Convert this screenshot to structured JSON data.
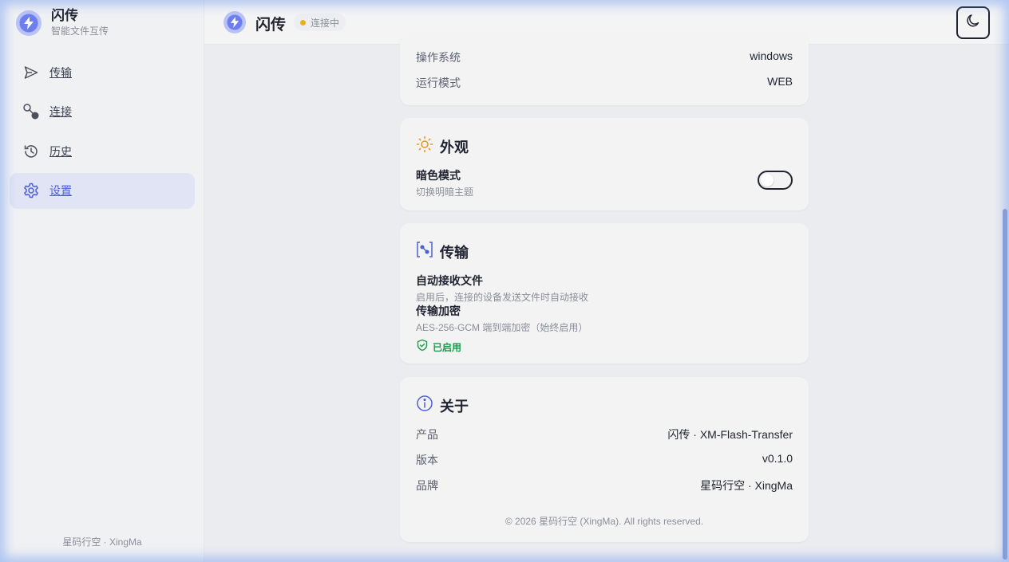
{
  "app": {
    "name": "闪传",
    "subtitle": "智能文件互传",
    "footer": "星码行空 · XingMa"
  },
  "sidebar": {
    "items": [
      {
        "label": "传输",
        "icon": "send-icon",
        "active": false
      },
      {
        "label": "连接",
        "icon": "connection-icon",
        "active": false
      },
      {
        "label": "历史",
        "icon": "history-icon",
        "active": false
      },
      {
        "label": "设置",
        "icon": "gear-icon",
        "active": true
      }
    ]
  },
  "header": {
    "title": "闪传",
    "status": "连接中",
    "theme_toggle_icon": "moon-icon"
  },
  "system": {
    "rows": [
      {
        "key": "操作系统",
        "value": "windows"
      },
      {
        "key": "运行模式",
        "value": "WEB"
      }
    ]
  },
  "appearance": {
    "title": "外观",
    "dark_mode_title": "暗色模式",
    "dark_mode_desc": "切换明暗主题",
    "dark_mode_on": false
  },
  "transfer": {
    "title": "传输",
    "auto_receive_title": "自动接收文件",
    "auto_receive_desc": "启用后，连接的设备发送文件时自动接收",
    "encryption_title": "传输加密",
    "encryption_desc": "AES-256-GCM 端到端加密（始终启用）",
    "encryption_status": "已启用"
  },
  "about": {
    "title": "关于",
    "rows": [
      {
        "key": "产品",
        "value": "闪传 · XM-Flash-Transfer"
      },
      {
        "key": "版本",
        "value": "v0.1.0"
      },
      {
        "key": "品牌",
        "value": "星码行空 · XingMa"
      }
    ],
    "copyright": "© 2026 星码行空 (XingMa). All rights reserved."
  },
  "colors": {
    "accent": "#4a5fd8",
    "status_pending": "#e6b11d",
    "success": "#1d9a4b",
    "appearance_icon": "#e8951c"
  }
}
